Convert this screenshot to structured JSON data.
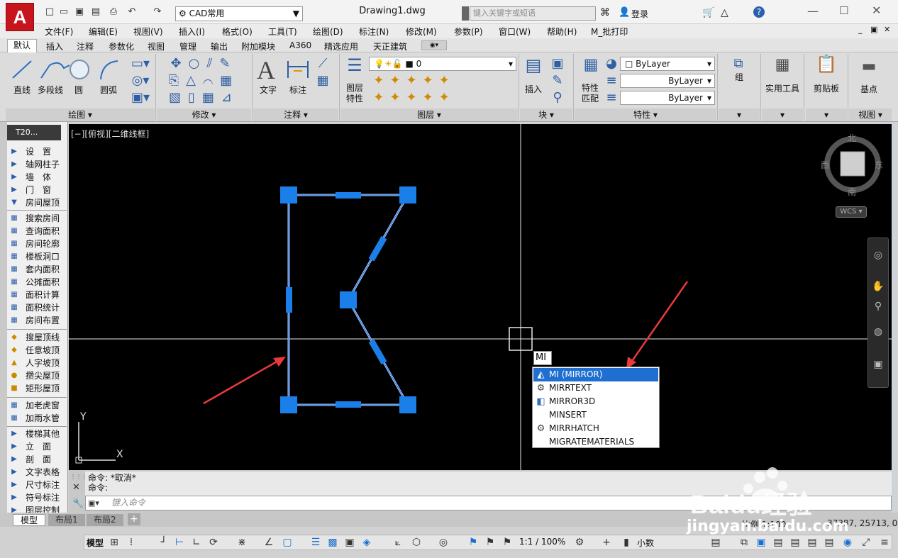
{
  "app": {
    "logo": "A",
    "workspace": "CAD常用",
    "doc_title": "Drawing1.dwg",
    "search_placeholder": "键入关键字或短语",
    "login": "登录"
  },
  "menus": [
    "文件(F)",
    "编辑(E)",
    "视图(V)",
    "插入(I)",
    "格式(O)",
    "工具(T)",
    "绘图(D)",
    "标注(N)",
    "修改(M)",
    "参数(P)",
    "窗口(W)",
    "帮助(H)",
    "M_批打印"
  ],
  "ribbon_tabs": [
    "默认",
    "插入",
    "注释",
    "参数化",
    "视图",
    "管理",
    "输出",
    "附加模块",
    "A360",
    "精选应用",
    "天正建筑"
  ],
  "ribbon": {
    "draw": {
      "title": "绘图",
      "line": "直线",
      "polyline": "多段线",
      "circle": "圆",
      "arc": "圆弧"
    },
    "modify": {
      "title": "修改"
    },
    "annotation": {
      "title": "注释",
      "text": "文字",
      "dim": "标注"
    },
    "layers": {
      "title": "图层",
      "props": "图层\n特性",
      "current": "0"
    },
    "block": {
      "title": "块",
      "insert": "插入"
    },
    "props": {
      "title": "特性",
      "match": "特性\n匹配",
      "color": "ByLayer",
      "linetype": "ByLayer",
      "lineweight": "ByLayer"
    },
    "group": {
      "title": "组",
      "label": "组"
    },
    "utilities": {
      "label": "实用工具"
    },
    "clipboard": {
      "label": "剪贴板"
    },
    "view": {
      "title": "视图",
      "label": "基点"
    }
  },
  "palette": {
    "header": "T20...",
    "group1": [
      "设　置",
      "轴网柱子",
      "墙　体",
      "门　窗",
      "房间屋顶"
    ],
    "group2": [
      "搜索房间",
      "查询面积",
      "房间轮廓",
      "楼板洞口",
      "套内面积",
      "公摊面积",
      "面积计算",
      "面积统计",
      "房间布置"
    ],
    "group3": [
      "搜屋顶线",
      "任意坡顶",
      "人字坡顶",
      "攒尖屋顶",
      "矩形屋顶"
    ],
    "group4": [
      "加老虎窗",
      "加雨水管"
    ],
    "group5": [
      "楼梯其他",
      "立　面",
      "剖　面",
      "文字表格",
      "尺寸标注",
      "符号标注",
      "图层控制"
    ]
  },
  "viewport_label": "[−][俯视][二维线框]",
  "viewcube": {
    "north": "北",
    "south": "南",
    "east": "东",
    "west": "西",
    "wcs": "WCS"
  },
  "ucs": {
    "x": "X",
    "y": "Y"
  },
  "command": {
    "line1": "命令: *取消*",
    "line2": "命令:",
    "input_placeholder": "键入命令",
    "typed": "MI"
  },
  "autocomplete": [
    "MI (MIRROR)",
    "MIRRTEXT",
    "MIRROR3D",
    "MINSERT",
    "MIRRHATCH",
    "MIGRATEMATERIALS"
  ],
  "layout_tabs": [
    "模型",
    "布局1",
    "布局2"
  ],
  "status": {
    "coords": "37387, 25713, 0",
    "scale": "比例 1:100",
    "model": "模型",
    "zoom": "1:1 / 100%",
    "precision": "小数"
  },
  "watermark": {
    "brand": "Baidu经验",
    "url": "jingyan.baidu.com"
  },
  "colors": {
    "selection": "#1a7fe8",
    "accent": "#c8141c",
    "arrow": "#e83a3a"
  }
}
